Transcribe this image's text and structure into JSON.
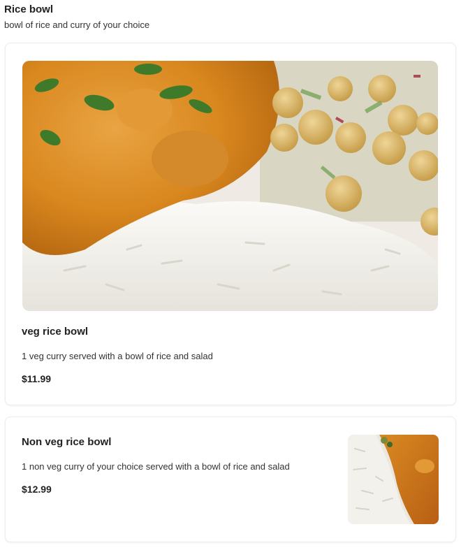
{
  "section": {
    "title": "Rice bowl",
    "description": "bowl of rice and curry of your choice"
  },
  "items": [
    {
      "name": "veg rice bowl",
      "description": "1 veg curry served with a bowl of rice and salad",
      "price": "$11.99",
      "image": "veg-rice-bowl-photo"
    },
    {
      "name": "Non veg rice bowl",
      "description": "1 non veg curry of your choice served with a bowl of rice and salad",
      "price": "$12.99",
      "image": "non-veg-rice-bowl-photo"
    }
  ],
  "colors": {
    "curry": "#d9871e",
    "rice": "#f4f2ec",
    "chickpea": "#d8b865",
    "cilantro": "#3f7a2a",
    "card_border": "#ececec"
  }
}
